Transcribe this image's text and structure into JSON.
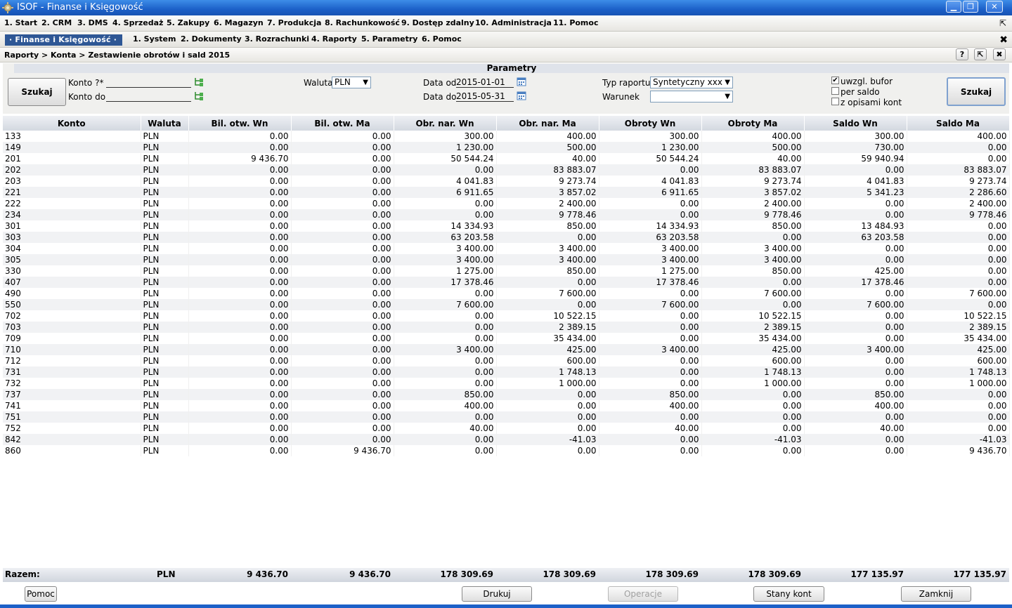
{
  "window": {
    "title": "ISOF - Finanse i Księgowość",
    "minimize": "▁",
    "restore": "❐",
    "close": "✕"
  },
  "menu": [
    "1. Start",
    "2. CRM",
    "3. DMS",
    "4. Sprzedaż",
    "5. Zakupy",
    "6. Magazyn",
    "7. Produkcja",
    "8. Rachunkowość",
    "9. Dostęp zdalny",
    "10. Administracja",
    "11. Pomoc"
  ],
  "module": {
    "active": "· Finanse i Księgowość ·",
    "items": [
      "1. System",
      "2. Dokumenty",
      "3. Rozrachunki",
      "4. Raporty",
      "5. Parametry",
      "6. Pomoc"
    ]
  },
  "breadcrumb": "Raporty > Konta > Zestawienie obrotów i sald 2015",
  "params": {
    "header": "Parametry",
    "search_left": "Szukaj",
    "search_right": "Szukaj",
    "konto_from_label": "Konto ?*",
    "konto_to_label": "Konto do",
    "waluta_label": "Waluta",
    "waluta_value": "PLN",
    "date_from_label": "Data od",
    "date_from": "2015-01-01",
    "date_to_label": "Data do",
    "date_to": "2015-05-31",
    "report_type_label": "Typ raportu",
    "report_type_value": "Syntetyczny xxx",
    "condition_label": "Warunek",
    "condition_value": "",
    "chk_bufor": {
      "label": "uwzgl. bufor",
      "checked": true
    },
    "chk_saldo": {
      "label": "per saldo",
      "checked": false
    },
    "chk_opisy": {
      "label": "z opisami kont",
      "checked": false
    }
  },
  "table": {
    "columns": [
      "Konto",
      "Waluta",
      "Bil. otw. Wn",
      "Bil. otw. Ma",
      "Obr. nar. Wn",
      "Obr. nar. Ma",
      "Obroty Wn",
      "Obroty Ma",
      "Saldo Wn",
      "Saldo Ma"
    ],
    "rows": [
      [
        "133",
        "PLN",
        "0.00",
        "0.00",
        "300.00",
        "400.00",
        "300.00",
        "400.00",
        "300.00",
        "400.00"
      ],
      [
        "149",
        "PLN",
        "0.00",
        "0.00",
        "1 230.00",
        "500.00",
        "1 230.00",
        "500.00",
        "730.00",
        "0.00"
      ],
      [
        "201",
        "PLN",
        "9 436.70",
        "0.00",
        "50 544.24",
        "40.00",
        "50 544.24",
        "40.00",
        "59 940.94",
        "0.00"
      ],
      [
        "202",
        "PLN",
        "0.00",
        "0.00",
        "0.00",
        "83 883.07",
        "0.00",
        "83 883.07",
        "0.00",
        "83 883.07"
      ],
      [
        "203",
        "PLN",
        "0.00",
        "0.00",
        "4 041.83",
        "9 273.74",
        "4 041.83",
        "9 273.74",
        "4 041.83",
        "9 273.74"
      ],
      [
        "221",
        "PLN",
        "0.00",
        "0.00",
        "6 911.65",
        "3 857.02",
        "6 911.65",
        "3 857.02",
        "5 341.23",
        "2 286.60"
      ],
      [
        "222",
        "PLN",
        "0.00",
        "0.00",
        "0.00",
        "2 400.00",
        "0.00",
        "2 400.00",
        "0.00",
        "2 400.00"
      ],
      [
        "234",
        "PLN",
        "0.00",
        "0.00",
        "0.00",
        "9 778.46",
        "0.00",
        "9 778.46",
        "0.00",
        "9 778.46"
      ],
      [
        "301",
        "PLN",
        "0.00",
        "0.00",
        "14 334.93",
        "850.00",
        "14 334.93",
        "850.00",
        "13 484.93",
        "0.00"
      ],
      [
        "303",
        "PLN",
        "0.00",
        "0.00",
        "63 203.58",
        "0.00",
        "63 203.58",
        "0.00",
        "63 203.58",
        "0.00"
      ],
      [
        "304",
        "PLN",
        "0.00",
        "0.00",
        "3 400.00",
        "3 400.00",
        "3 400.00",
        "3 400.00",
        "0.00",
        "0.00"
      ],
      [
        "305",
        "PLN",
        "0.00",
        "0.00",
        "3 400.00",
        "3 400.00",
        "3 400.00",
        "3 400.00",
        "0.00",
        "0.00"
      ],
      [
        "330",
        "PLN",
        "0.00",
        "0.00",
        "1 275.00",
        "850.00",
        "1 275.00",
        "850.00",
        "425.00",
        "0.00"
      ],
      [
        "407",
        "PLN",
        "0.00",
        "0.00",
        "17 378.46",
        "0.00",
        "17 378.46",
        "0.00",
        "17 378.46",
        "0.00"
      ],
      [
        "490",
        "PLN",
        "0.00",
        "0.00",
        "0.00",
        "7 600.00",
        "0.00",
        "7 600.00",
        "0.00",
        "7 600.00"
      ],
      [
        "550",
        "PLN",
        "0.00",
        "0.00",
        "7 600.00",
        "0.00",
        "7 600.00",
        "0.00",
        "7 600.00",
        "0.00"
      ],
      [
        "702",
        "PLN",
        "0.00",
        "0.00",
        "0.00",
        "10 522.15",
        "0.00",
        "10 522.15",
        "0.00",
        "10 522.15"
      ],
      [
        "703",
        "PLN",
        "0.00",
        "0.00",
        "0.00",
        "2 389.15",
        "0.00",
        "2 389.15",
        "0.00",
        "2 389.15"
      ],
      [
        "709",
        "PLN",
        "0.00",
        "0.00",
        "0.00",
        "35 434.00",
        "0.00",
        "35 434.00",
        "0.00",
        "35 434.00"
      ],
      [
        "710",
        "PLN",
        "0.00",
        "0.00",
        "3 400.00",
        "425.00",
        "3 400.00",
        "425.00",
        "3 400.00",
        "425.00"
      ],
      [
        "712",
        "PLN",
        "0.00",
        "0.00",
        "0.00",
        "600.00",
        "0.00",
        "600.00",
        "0.00",
        "600.00"
      ],
      [
        "731",
        "PLN",
        "0.00",
        "0.00",
        "0.00",
        "1 748.13",
        "0.00",
        "1 748.13",
        "0.00",
        "1 748.13"
      ],
      [
        "732",
        "PLN",
        "0.00",
        "0.00",
        "0.00",
        "1 000.00",
        "0.00",
        "1 000.00",
        "0.00",
        "1 000.00"
      ],
      [
        "737",
        "PLN",
        "0.00",
        "0.00",
        "850.00",
        "0.00",
        "850.00",
        "0.00",
        "850.00",
        "0.00"
      ],
      [
        "741",
        "PLN",
        "0.00",
        "0.00",
        "400.00",
        "0.00",
        "400.00",
        "0.00",
        "400.00",
        "0.00"
      ],
      [
        "751",
        "PLN",
        "0.00",
        "0.00",
        "0.00",
        "0.00",
        "0.00",
        "0.00",
        "0.00",
        "0.00"
      ],
      [
        "752",
        "PLN",
        "0.00",
        "0.00",
        "40.00",
        "0.00",
        "40.00",
        "0.00",
        "40.00",
        "0.00"
      ],
      [
        "842",
        "PLN",
        "0.00",
        "0.00",
        "0.00",
        "-41.03",
        "0.00",
        "-41.03",
        "0.00",
        "-41.03"
      ],
      [
        "860",
        "PLN",
        "0.00",
        "9 436.70",
        "0.00",
        "0.00",
        "0.00",
        "0.00",
        "0.00",
        "9 436.70"
      ]
    ],
    "totals": [
      "Razem:",
      "PLN",
      "9 436.70",
      "9 436.70",
      "178 309.69",
      "178 309.69",
      "178 309.69",
      "178 309.69",
      "177 135.97",
      "177 135.97"
    ]
  },
  "buttons": {
    "help": "Pomoc",
    "print": "Drukuj",
    "operations": "Operacje",
    "account_states": "Stany kont",
    "close": "Zamknij"
  },
  "breadcrumb_tools": {
    "help": "?",
    "popout": "⇱",
    "close": "✖"
  },
  "colors": {
    "titlebar": "#1c60c8",
    "module_tab": "#2e5795",
    "row_stripe": "#f1f2f4",
    "header_bg": "#d3d8e0"
  }
}
